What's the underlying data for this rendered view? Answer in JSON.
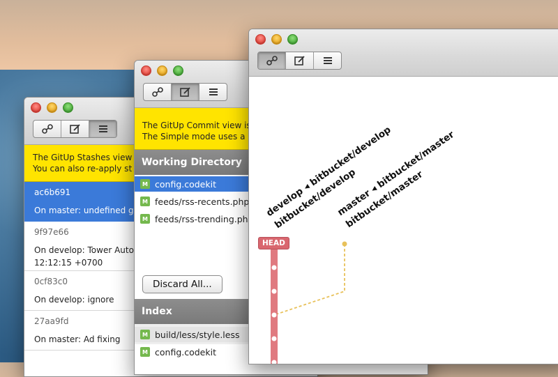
{
  "stashes_window": {
    "toolbar": [
      "map-view",
      "commit-view",
      "stashes-view"
    ],
    "banner_lines": [
      "The GitUp Stashes view l",
      "You can also re-apply st"
    ],
    "stashes": [
      {
        "id": "ac6b691",
        "message": "On master: undefined g",
        "selected": true
      },
      {
        "id": "9f97e66",
        "message": "On develop: Tower Auto",
        "message2": "12:12:15 +0700",
        "selected": false
      },
      {
        "id": "0cf83c0",
        "message": "On develop: ignore",
        "selected": false
      },
      {
        "id": "27aa9fd",
        "message": "On master: Ad fixing",
        "selected": false
      }
    ]
  },
  "commit_window": {
    "banner_lines": [
      "The GitUp Commit view is",
      "The Simple mode uses a u"
    ],
    "working_directory_title": "Working Directory",
    "working_files": [
      {
        "status": "M",
        "name": "config.codekit",
        "selected": true
      },
      {
        "status": "M",
        "name": "feeds/rss-recents.php",
        "selected": false
      },
      {
        "status": "M",
        "name": "feeds/rss-trending.php",
        "selected": false
      }
    ],
    "discard_label": "Discard All...",
    "index_title": "Index",
    "index_files": [
      {
        "status": "M",
        "name": "build/less/style.less"
      },
      {
        "status": "M",
        "name": "config.codekit"
      }
    ]
  },
  "map_window": {
    "labels": {
      "develop_line1": "develop ◂ bitbucket/develop",
      "develop_line2": "bitbucket/develop",
      "master_line1": "master ◂ bitbucket/master",
      "master_line2": "bitbucket/master"
    },
    "head_label": "HEAD",
    "colors": {
      "head_branch": "#e07a80",
      "master_branch": "#e8c15a"
    }
  }
}
